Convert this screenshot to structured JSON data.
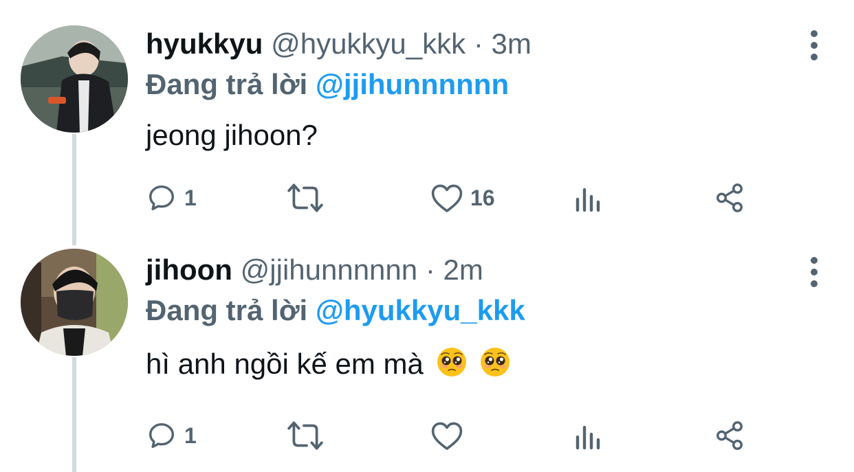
{
  "tweets": [
    {
      "display_name": "hyukkyu",
      "handle": "@hyukkyu_kkk",
      "separator": "·",
      "time": "3m",
      "replying_label": "Đang trả lời",
      "replying_to": "@jjihunnnnnn",
      "text": "jeong jihoon?",
      "emoji": "",
      "reply_count": "1",
      "retweet_count": "",
      "like_count": "16"
    },
    {
      "display_name": "jihoon",
      "handle": "@jjihunnnnnn",
      "separator": "·",
      "time": "2m",
      "replying_label": "Đang trả lời",
      "replying_to": "@hyukkyu_kkk",
      "text": "hì anh ngồi kế em mà",
      "emoji": "pleading-face ×2",
      "reply_count": "1",
      "retweet_count": "",
      "like_count": ""
    }
  ],
  "icons": [
    "reply-icon",
    "retweet-icon",
    "like-icon",
    "views-icon",
    "share-icon",
    "more-icon"
  ],
  "colors": {
    "accent": "#1d9bf0",
    "muted": "#536471",
    "text": "#0f1419",
    "thread_line": "#cfd9de"
  }
}
